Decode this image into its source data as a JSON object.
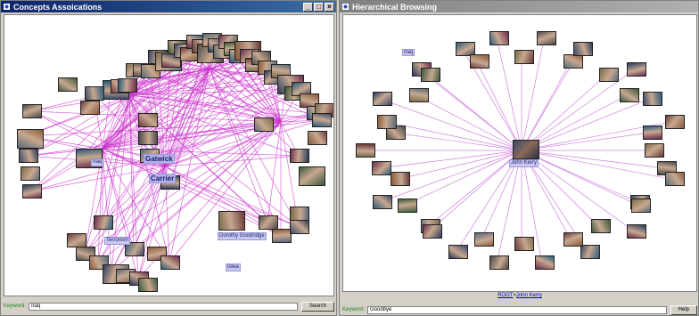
{
  "left_window": {
    "title": "Concepts Assoications",
    "node_labels": [
      "Iraq",
      "Gatwick",
      "Carrier",
      "Terrorism",
      "Iowa",
      "Dorothy Goodridge"
    ],
    "keyword_label": "Keyword:",
    "keyword_value": "Iraq",
    "search_label": "Search",
    "edge_color": "#cc33cc",
    "label_bg": "#c8c8f0",
    "title_color": "#0a246a"
  },
  "right_window": {
    "title": "Hierarchical Browsing",
    "center_label": "John Kerry",
    "corner_label": "Iraq",
    "breadcrumb_root": "ROOT",
    "breadcrumb_sep": ">",
    "breadcrumb_current": "John Kerry",
    "keyword_label": "Keyword:",
    "keyword_value": "Goodbye",
    "help_label": "Help",
    "edge_color": "#d080e0"
  }
}
